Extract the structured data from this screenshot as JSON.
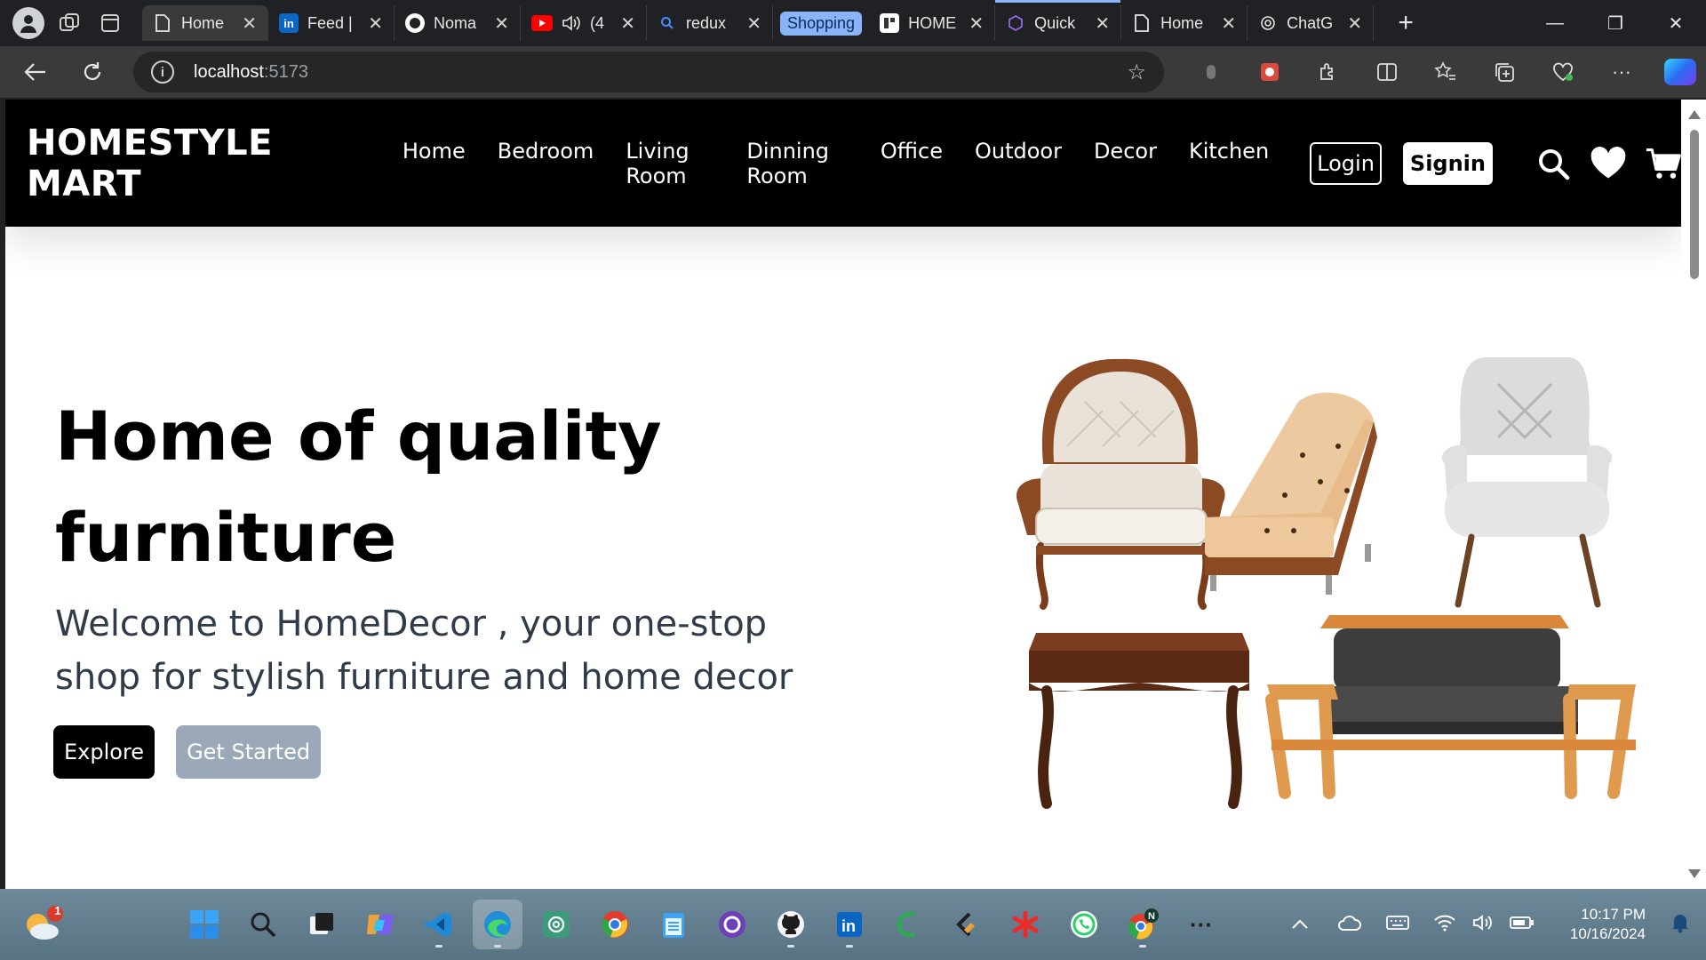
{
  "browser": {
    "tabs": [
      {
        "title": "Home",
        "icon": "document-icon",
        "active": true
      },
      {
        "title": "Feed |",
        "icon": "linkedin-icon"
      },
      {
        "title": "Noma",
        "icon": "github-icon"
      },
      {
        "title": "(4",
        "icon": "youtube-icon"
      },
      {
        "title": "redux",
        "icon": "search-icon"
      },
      {
        "title": "Shopping",
        "icon": "tab-group-chip"
      },
      {
        "title": "HOME",
        "icon": "site-icon"
      },
      {
        "title": "Quick",
        "icon": "graphql-icon"
      },
      {
        "title": "Home",
        "icon": "document-icon"
      },
      {
        "title": "ChatG",
        "icon": "chatgpt-icon"
      }
    ],
    "url_host": "localhost",
    "url_port": ":5173"
  },
  "site": {
    "brand": "HOMESTYLE MART",
    "menu": [
      "Home",
      "Bedroom",
      "Living Room",
      "Dinning Room",
      "Office",
      "Outdoor",
      "Decor",
      "Kitchen"
    ],
    "login_label": "Login",
    "signin_label": "Signin"
  },
  "hero": {
    "title_line1": "Home of quality",
    "title_line2": "furniture",
    "subtitle": "Welcome to HomeDecor , your one-stop shop for stylish furniture and home decor",
    "explore_label": "Explore",
    "start_label": "Get Started"
  },
  "taskbar": {
    "notification_badge": "1",
    "time": "10:17 PM",
    "date": "10/16/2024"
  },
  "colors": {
    "header_bg": "#000000",
    "accent_blue": "#8ab4f8",
    "start_button": "#9ba8b8",
    "subtitle_text": "#2f3b48"
  }
}
